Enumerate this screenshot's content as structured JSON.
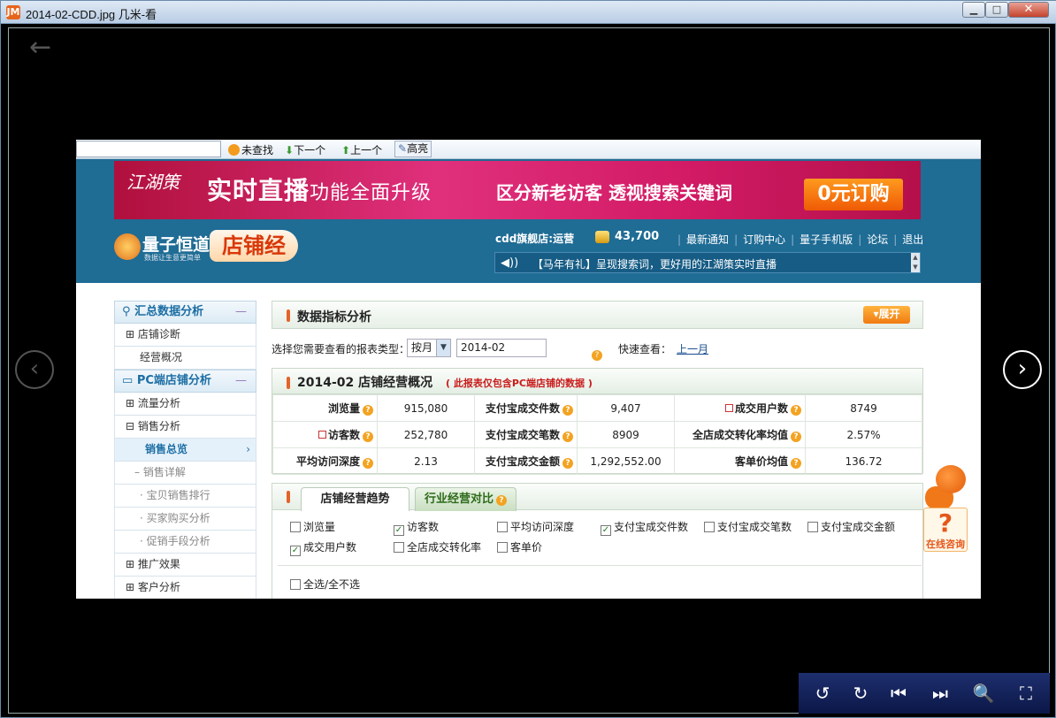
{
  "window": {
    "title": "2014-02-CDD.jpg 几米-看",
    "app_icon": "JM"
  },
  "viewer": {
    "back_icon": "←",
    "prev_icon": "‹",
    "next_icon": "›"
  },
  "toolbar": {
    "rotate_left": "↺",
    "rotate_right": "↻",
    "first": "⏮",
    "last": "⏭",
    "zoom": "🔍",
    "fullscreen": "⛶"
  },
  "findbar": {
    "not_found": "未查找",
    "next": "下一个",
    "prev": "上一个",
    "highlight": "高亮"
  },
  "banner": {
    "brand": "江湖策",
    "main_big": "实时直播",
    "main_small": "功能全面升级",
    "sub": "区分新老访客 透视搜索关键词",
    "cta": "0元订购",
    "close": "✕"
  },
  "logo": {
    "name": "量子恒道",
    "tagline": "数据让生意更简单",
    "product": "店铺经"
  },
  "header": {
    "shop": "cdd旗舰店:运营",
    "coins": "43,700",
    "links": [
      "最新通知",
      "订购中心",
      "量子手机版",
      "论坛",
      "退出"
    ],
    "news": "【马年有礼】呈现搜索词，更好用的江湖策实时直播"
  },
  "sidebar": {
    "group1": "汇总数据分析",
    "group1_items": [
      "店铺诊断",
      "经营概况"
    ],
    "group2": "PC端店铺分析",
    "traffic": "流量分析",
    "sales": "销售分析",
    "sales_overview": "销售总览",
    "sales_detail": "销售详解",
    "rank": "宝贝销售排行",
    "buyer": "买家购买分析",
    "promo": "促销手段分析",
    "ads": "推广效果",
    "customer": "客户分析"
  },
  "section": {
    "title": "数据指标分析",
    "expand": "展开",
    "report_label": "选择您需要查看的报表类型：",
    "period": "按月",
    "month": "2014-02",
    "quick_label": "快速查看：",
    "quick_link": "上一月"
  },
  "overview": {
    "title": "2014-02 店铺经营概况",
    "note": "( 此报表仅包含PC端店铺的数据 )",
    "rows": [
      [
        {
          "label": "浏览量",
          "value": "915,080"
        },
        {
          "label": "支付宝成交件数",
          "value": "9,407"
        },
        {
          "label": "成交用户数",
          "value": "8749"
        }
      ],
      [
        {
          "label": "访客数",
          "value": "252,780"
        },
        {
          "label": "支付宝成交笔数",
          "value": "8909"
        },
        {
          "label": "全店成交转化率均值",
          "value": "2.57%"
        }
      ],
      [
        {
          "label": "平均访问深度",
          "value": "2.13"
        },
        {
          "label": "支付宝成交金额",
          "value": "1,292,552.00"
        },
        {
          "label": "客单价均值",
          "value": "136.72"
        }
      ]
    ]
  },
  "trend": {
    "tab_active": "店铺经营趋势",
    "tab_other": "行业经营对比",
    "options": [
      {
        "label": "浏览量",
        "checked": false
      },
      {
        "label": "访客数",
        "checked": true
      },
      {
        "label": "平均访问深度",
        "checked": false
      },
      {
        "label": "支付宝成交件数",
        "checked": true
      },
      {
        "label": "支付宝成交笔数",
        "checked": false
      },
      {
        "label": "支付宝成交金额",
        "checked": false
      },
      {
        "label": "成交用户数",
        "checked": true
      },
      {
        "label": "全店成交转化率",
        "checked": false
      },
      {
        "label": "客单价",
        "checked": false
      }
    ],
    "select_all": "全选/全不选"
  },
  "helper": {
    "symbol": "?",
    "label": "在线咨询"
  }
}
